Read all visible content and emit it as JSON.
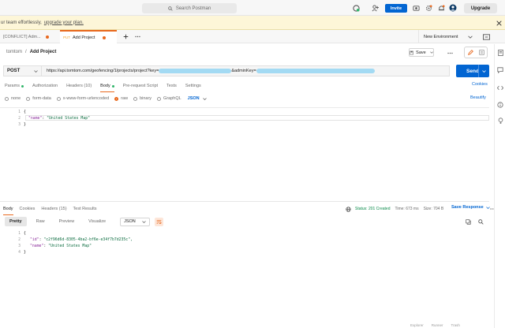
{
  "topbar": {
    "search_placeholder": "Search Postman",
    "invite_label": "Invite",
    "upgrade_label": "Upgrade"
  },
  "banner": {
    "text": "ur team effortlessly,",
    "link": "upgrade your plan."
  },
  "tabs": [
    {
      "method": "",
      "label": "[CONFLICT] Adm..."
    },
    {
      "method": "PUT",
      "label": "Add Project"
    }
  ],
  "environment": {
    "selected": "New Environment"
  },
  "breadcrumb": {
    "workspace": "tomtom",
    "separator": "/",
    "current": "Add Project"
  },
  "request": {
    "save_label": "Save",
    "method": "POST",
    "url_prefix": "https://api.tomtom.com/geofencing/1/projects/project?key=",
    "url_mid": "&adminKey=",
    "send_label": "Send"
  },
  "request_tabs": [
    {
      "label": "Params",
      "dot": true
    },
    {
      "label": "Authorization",
      "dot": false
    },
    {
      "label": "Headers (10)",
      "dot": false
    },
    {
      "label": "Body",
      "dot": true,
      "active": true
    },
    {
      "label": "Pre-request Script",
      "dot": false
    },
    {
      "label": "Tests",
      "dot": false
    },
    {
      "label": "Settings",
      "dot": false
    }
  ],
  "cookies_label": "Cookies",
  "body_types": {
    "none": "none",
    "form_data": "form-data",
    "urlencoded": "x-www-form-urlencoded",
    "raw": "raw",
    "binary": "binary",
    "graphql": "GraphQL",
    "format": "JSON",
    "beautify": "Beautify"
  },
  "request_body": {
    "lines": [
      "1",
      "2",
      "3"
    ],
    "open": "{",
    "key": "\"name\"",
    "colon": ": ",
    "value": "\"United States Map\"",
    "close": "}"
  },
  "response_tabs": [
    {
      "label": "Body",
      "active": true
    },
    {
      "label": "Cookies"
    },
    {
      "label": "Headers (15)"
    },
    {
      "label": "Test Results"
    }
  ],
  "response_status": {
    "status": "Status: 201 Created",
    "time": "Time: 673 ms",
    "size": "Size: 704 B",
    "save_response": "Save Response"
  },
  "view_tabs": {
    "pretty": "Pretty",
    "raw": "Raw",
    "preview": "Preview",
    "visualize": "Visualize",
    "format": "JSON"
  },
  "response_body": {
    "lines": [
      "1",
      "2",
      "3",
      "4"
    ],
    "open": "{",
    "id_key": "\"id\"",
    "id_value": "\"c2f96d6d-8305-4ba2-bf6e-e34f7b7d235c\",",
    "name_key": "\"name\"",
    "name_value": "\"United States Map\"",
    "colon": ": ",
    "close": "}"
  },
  "footer": {
    "explorer": "Explorer",
    "runner": "Runner",
    "trash": "Trash"
  },
  "colors": {
    "accent": "#e8681d",
    "primary": "#0265d2",
    "success": "#2fb569"
  }
}
